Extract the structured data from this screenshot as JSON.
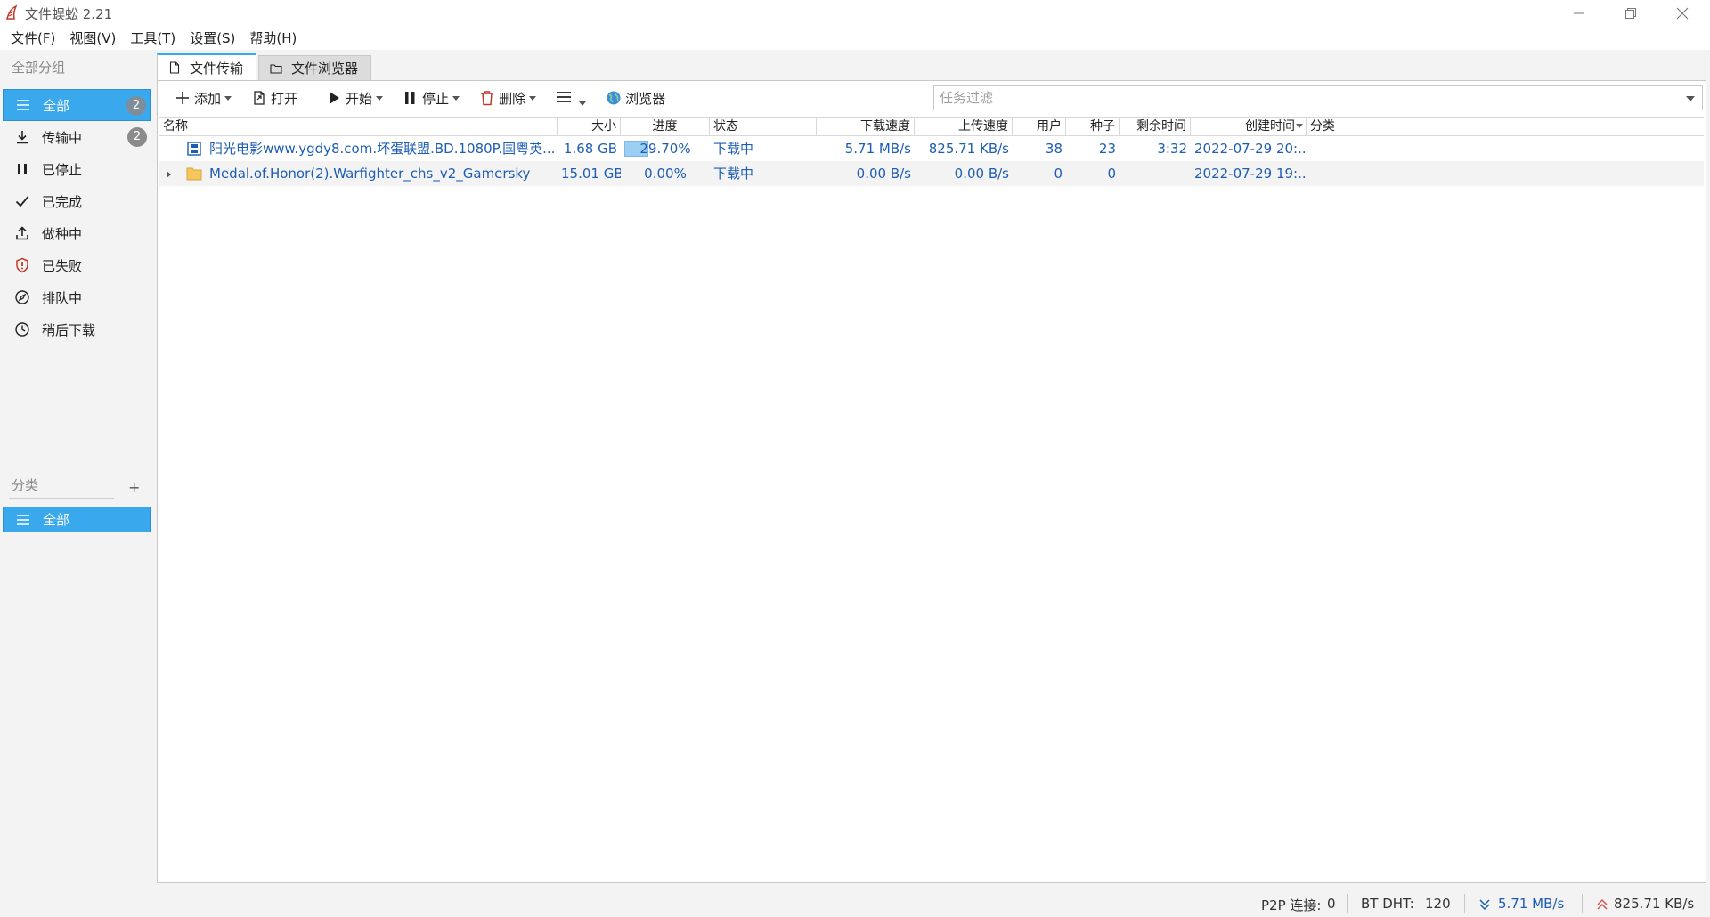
{
  "app": {
    "title": "文件蜈蚣 2.21"
  },
  "menu": [
    "文件(F)",
    "视图(V)",
    "工具(T)",
    "设置(S)",
    "帮助(H)"
  ],
  "sidebar": {
    "header": "全部分组",
    "groups": [
      {
        "label": "全部",
        "badge": "2",
        "icon": "list-icon",
        "active": true
      },
      {
        "label": "传输中",
        "badge": "2",
        "icon": "download-icon"
      },
      {
        "label": "已停止",
        "icon": "pause-icon"
      },
      {
        "label": "已完成",
        "icon": "check-icon"
      },
      {
        "label": "做种中",
        "icon": "upload-icon"
      },
      {
        "label": "已失败",
        "icon": "shield-alert-icon"
      },
      {
        "label": "排队中",
        "icon": "compass-icon"
      },
      {
        "label": "稍后下载",
        "icon": "clock-icon"
      }
    ],
    "category_header": "分类",
    "category_add": "+",
    "categories": [
      {
        "label": "全部",
        "icon": "list-icon",
        "active": true
      }
    ]
  },
  "tabs": [
    {
      "label": "文件传输",
      "icon": "file-icon",
      "active": true
    },
    {
      "label": "文件浏览器",
      "icon": "folder-icon",
      "active": false
    }
  ],
  "toolbar": {
    "add": "添加",
    "open": "打开",
    "start": "开始",
    "stop": "停止",
    "delete": "删除",
    "browser": "浏览器",
    "filter_placeholder": "任务过滤"
  },
  "table": {
    "columns": [
      "名称",
      "大小",
      "进度",
      "状态",
      "下载速度",
      "上传速度",
      "用户",
      "种子",
      "剩余时间",
      "创建时间",
      "分类"
    ],
    "rows": [
      {
        "name": "阳光电影www.ygdy8.com.坏蛋联盟.BD.1080P.国粤英...",
        "size": "1.68 GB",
        "progress": "29.70%",
        "progress_value": 29.7,
        "status": "下载中",
        "down_speed": "5.71 MB/s",
        "up_speed": "825.71 KB/s",
        "users": "38",
        "seeds": "23",
        "remaining": "3:32",
        "created": "2022-07-29 20:...",
        "category": "",
        "icon": "film-icon"
      },
      {
        "name": "Medal.of.Honor(2).Warfighter_chs_v2_Gamersky",
        "size": "15.01 GB",
        "progress": "0.00%",
        "progress_value": 0,
        "status": "下载中",
        "down_speed": "0.00 B/s",
        "up_speed": "0.00 B/s",
        "users": "0",
        "seeds": "0",
        "remaining": "",
        "created": "2022-07-29 19:...",
        "category": "",
        "icon": "folder-icon"
      }
    ]
  },
  "status": {
    "p2p_label": "P2P 连接:",
    "p2p_value": "0",
    "dht_label": "BT DHT:",
    "dht_value": "120",
    "down_speed": "5.71 MB/s",
    "up_speed": "825.71 KB/s"
  },
  "colors": {
    "accent": "#3aa8ec",
    "link": "#1d5db3",
    "progress": "#9ccdf2",
    "up_arrow": "#d9534f"
  }
}
